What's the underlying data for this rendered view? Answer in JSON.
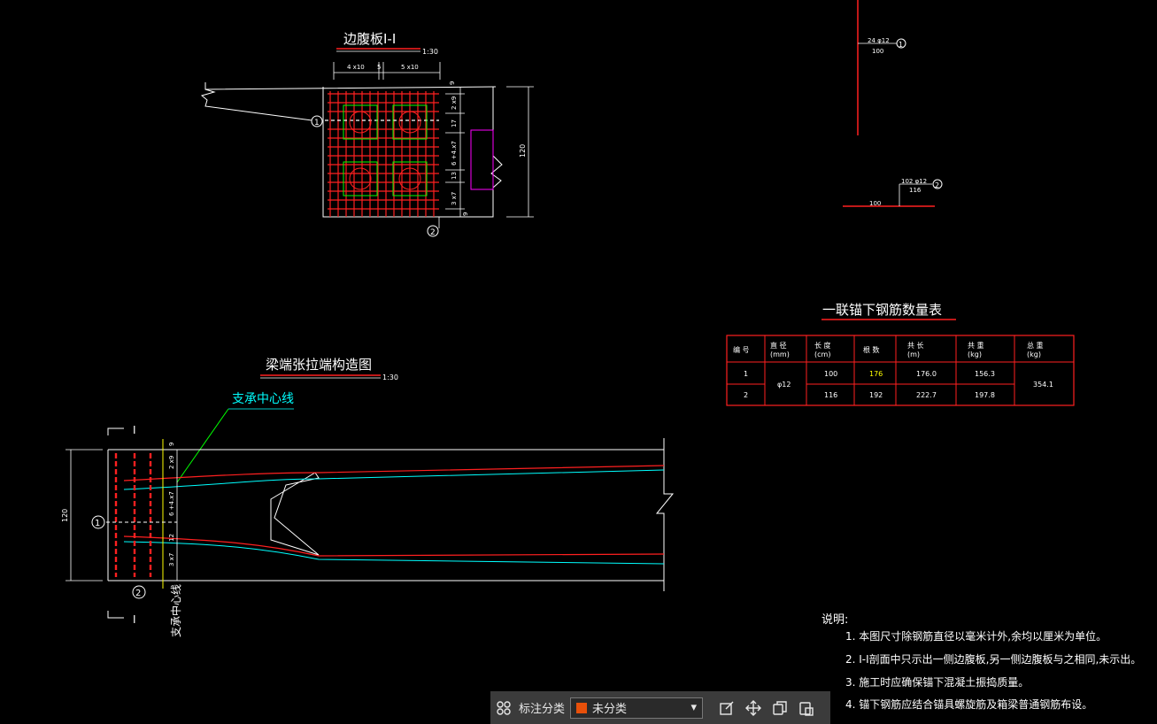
{
  "colors": {
    "bg": "#000000",
    "line": "#ffffff",
    "rebar": "#ff2020",
    "cyan": "#00ffff",
    "green": "#00ff00",
    "magenta": "#ff00ff",
    "yellow": "#ffff00",
    "swatch": "#e8500a"
  },
  "section": {
    "title": "边腹板Ⅰ-Ⅰ",
    "scale": "1:30",
    "dim_4x10": "4 x10",
    "dim_5": "5",
    "dim_5x10": "5 x10",
    "dim_9": "9",
    "dims_right": [
      "2 x9",
      "17",
      "6 +4.x7",
      "13",
      "3 x7"
    ],
    "dim_9b": "9",
    "dim_120": "120",
    "marker1": "1",
    "marker2": "2"
  },
  "rebar1": {
    "label": "24 φ12",
    "sub": "100",
    "marker": "1"
  },
  "rebar2": {
    "label": "102 φ12",
    "sub": "116",
    "dim": "100",
    "marker": "2"
  },
  "table": {
    "title": "一联锚下钢筋数量表",
    "headers": [
      "编 号",
      "直 径\n(mm)",
      "长 度\n(cm)",
      "根 数",
      "共 长\n(m)",
      "共 重\n(kg)",
      "总 重\n(kg)"
    ],
    "rows": [
      [
        "1",
        "",
        "100",
        "176",
        "176.0",
        "156.3",
        ""
      ],
      [
        "2",
        "",
        "116",
        "192",
        "222.7",
        "197.8",
        ""
      ]
    ],
    "diameter": "φ12",
    "total": "354.1"
  },
  "elevation": {
    "title": "梁端张拉端构造图",
    "scale": "1:30",
    "label_support": "支承中心线",
    "label_support_v": "支承中心线",
    "dim_120": "120",
    "dims": [
      "2 x9",
      "6 +4.x7",
      "12",
      "3 x7"
    ],
    "dim_9": "9",
    "section_mark": "Ⅰ",
    "marker1": "1",
    "marker2": "2"
  },
  "notes": {
    "heading": "说明:",
    "items": [
      "1. 本图尺寸除钢筋直径以毫米计外,余均以厘米为单位。",
      "2. Ⅰ-Ⅰ剖面中只示出一侧边腹板,另一侧边腹板与之相同,未示出。",
      "3. 施工时应确保锚下混凝土振捣质量。",
      "4. 锚下钢筋应结合锚具螺旋筋及箱梁普通钢筋布设。"
    ]
  },
  "toolbar": {
    "label": "标注分类",
    "selected": "未分类"
  }
}
